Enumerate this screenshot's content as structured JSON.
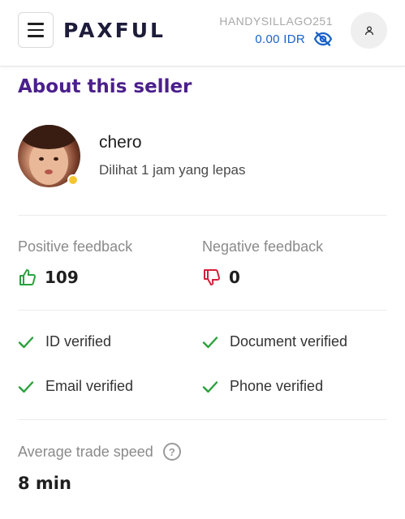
{
  "header": {
    "logo": "PAXFUL",
    "username": "HANDYSILLAGO251",
    "balance": "0.00 IDR"
  },
  "seller_section": {
    "title": "About this seller",
    "name": "chero",
    "last_seen": "Dilihat 1 jam yang lepas"
  },
  "feedback": {
    "positive_label": "Positive feedback",
    "positive_count": "109",
    "negative_label": "Negative feedback",
    "negative_count": "0"
  },
  "verifications": {
    "id": "ID verified",
    "document": "Document verified",
    "email": "Email verified",
    "phone": "Phone verified"
  },
  "trade_speed": {
    "label": "Average trade speed",
    "value": "8 min"
  },
  "colors": {
    "title_purple": "#4b1f8c",
    "balance_blue": "#1b62c6",
    "positive_green": "#2aa13c",
    "negative_red": "#d0213a",
    "status_yellow": "#f5c536"
  }
}
